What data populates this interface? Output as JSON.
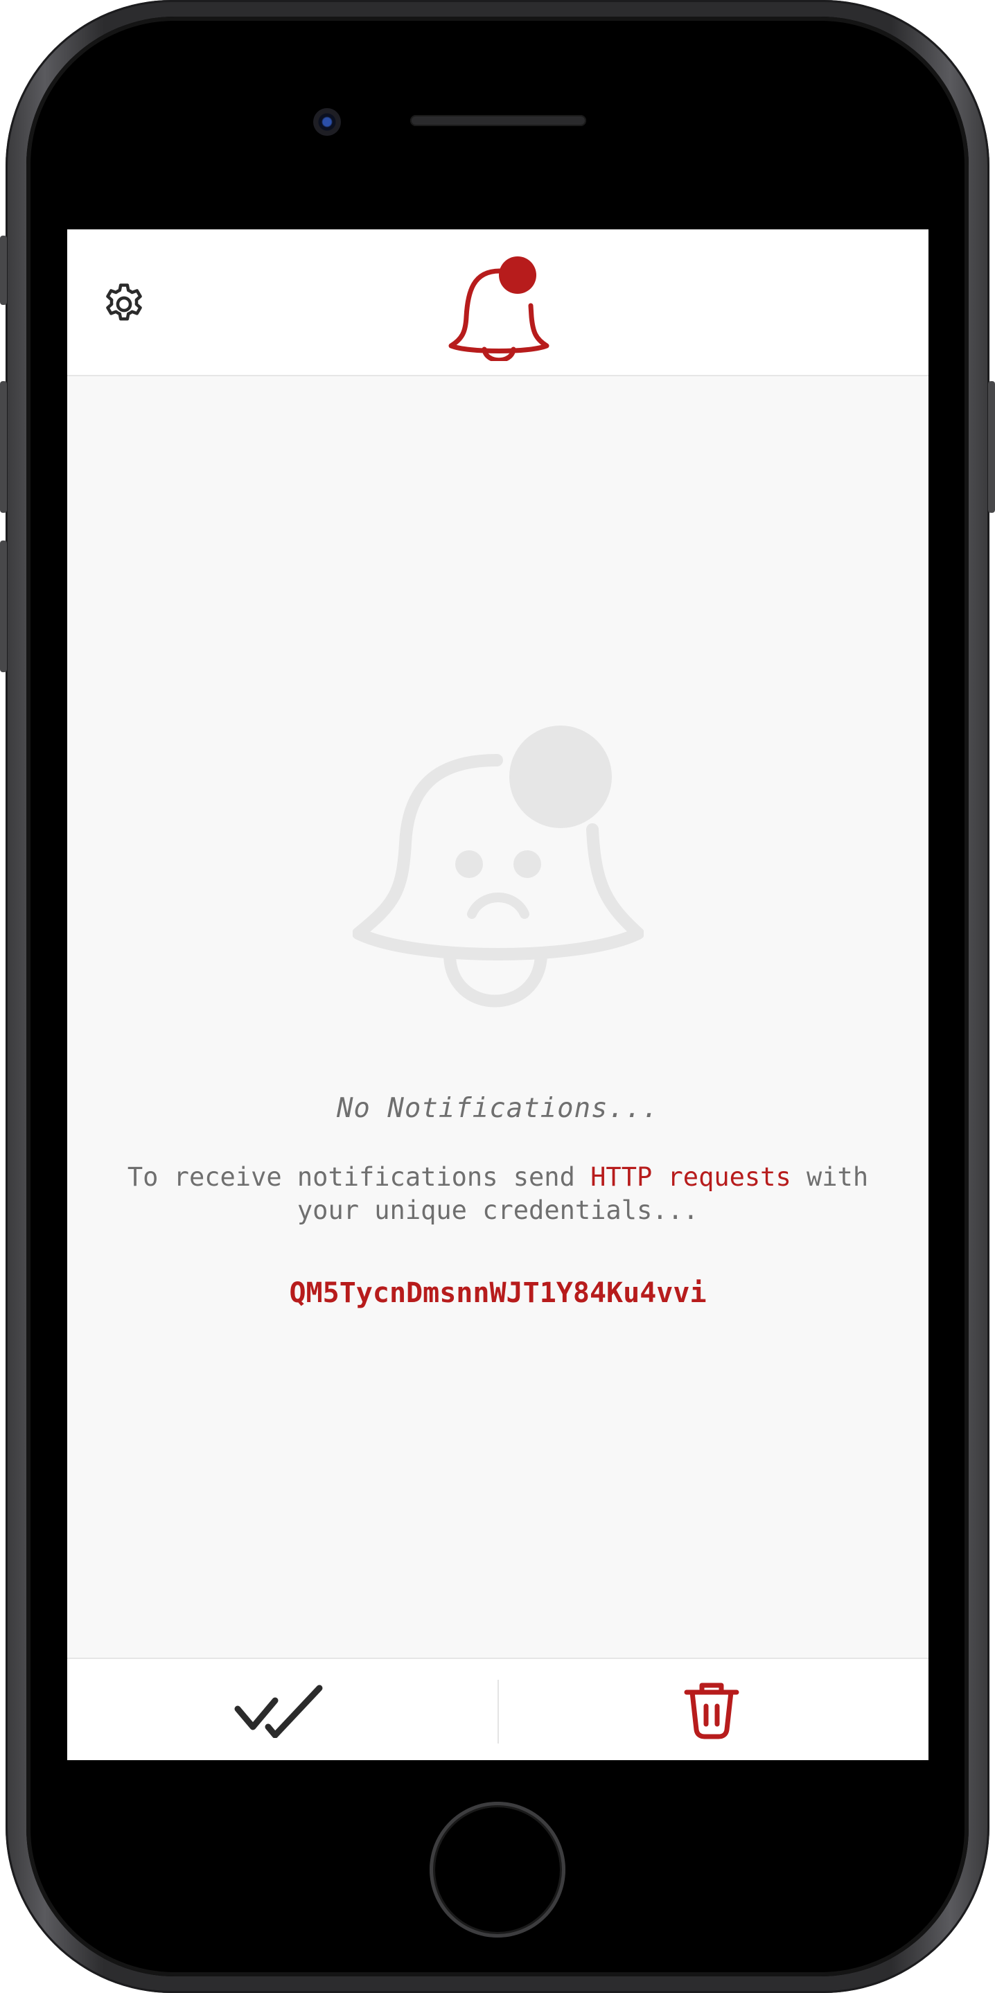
{
  "colors": {
    "accent": "#b71c1c",
    "muted_text": "#6f6f6f",
    "placeholder_art": "#e6e6e6",
    "background": "#f8f8f8",
    "bar_background": "#ffffff"
  },
  "header": {
    "settings_icon": "gear-icon",
    "logo_icon": "bell-notification-icon"
  },
  "empty_state": {
    "illustration_icon": "sad-bell-icon",
    "title": "No Notifications...",
    "description_before": "To receive notifications send ",
    "description_link": "HTTP requests",
    "description_after": " with your unique credentials...",
    "credential": "QM5TycnDmsnnWJT1Y84Ku4vvi"
  },
  "footer": {
    "mark_all_read_icon": "double-check-icon",
    "delete_all_icon": "trash-icon"
  }
}
